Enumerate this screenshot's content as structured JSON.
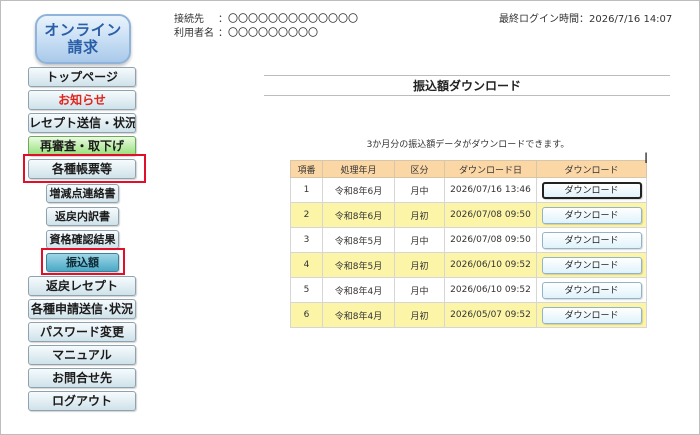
{
  "logo": {
    "line1": "オンライン",
    "line2": "請求"
  },
  "header": {
    "connection_label": "接続先",
    "connection_value": "：〇〇〇〇〇〇〇〇〇〇〇〇〇",
    "user_label": "利用者名",
    "user_value": "：〇〇〇〇〇〇〇〇〇",
    "last_login_label": "最終ログイン時間",
    "last_login_value": "：2026/7/16 14:07"
  },
  "nav": {
    "top": "トップページ",
    "notice": "お知らせ",
    "receipt_send": "レセプト送信・状況",
    "re_review": "再審査・取下げ",
    "forms": "各種帳票等",
    "sub_increase": "増減点連絡書",
    "sub_return": "返戻内訳書",
    "sub_eligibility": "資格確認結果",
    "sub_transfer": "振込額",
    "return_receipt": "返戻レセプト",
    "apply_send": "各種申請送信･状況",
    "password": "パスワード変更",
    "manual": "マニュアル",
    "contact": "お問合せ先",
    "logout": "ログアウト"
  },
  "page": {
    "title": "振込額ダウンロード",
    "description": "3か月分の振込額データがダウンロードできます。"
  },
  "table": {
    "headers": {
      "no": "項番",
      "month": "処理年月",
      "type": "区分",
      "date": "ダウンロード日",
      "download": "ダウンロード"
    },
    "rows": [
      {
        "no": "1",
        "month": "令和8年6月",
        "type": "月中",
        "date": "2026/07/16 13:46",
        "button": "ダウンロード"
      },
      {
        "no": "2",
        "month": "令和8年6月",
        "type": "月初",
        "date": "2026/07/08 09:50",
        "button": "ダウンロード"
      },
      {
        "no": "3",
        "month": "令和8年5月",
        "type": "月中",
        "date": "2026/07/08 09:50",
        "button": "ダウンロード"
      },
      {
        "no": "4",
        "month": "令和8年5月",
        "type": "月初",
        "date": "2026/06/10 09:52",
        "button": "ダウンロード"
      },
      {
        "no": "5",
        "month": "令和8年4月",
        "type": "月中",
        "date": "2026/06/10 09:52",
        "button": "ダウンロード"
      },
      {
        "no": "6",
        "month": "令和8年4月",
        "type": "月初",
        "date": "2026/05/07 09:52",
        "button": "ダウンロード"
      }
    ]
  },
  "colors": {
    "highlight": "#e0102a",
    "table_header": "#fcd7a6",
    "row_alt": "#fcf5a8",
    "notice_text": "#e0241c"
  }
}
